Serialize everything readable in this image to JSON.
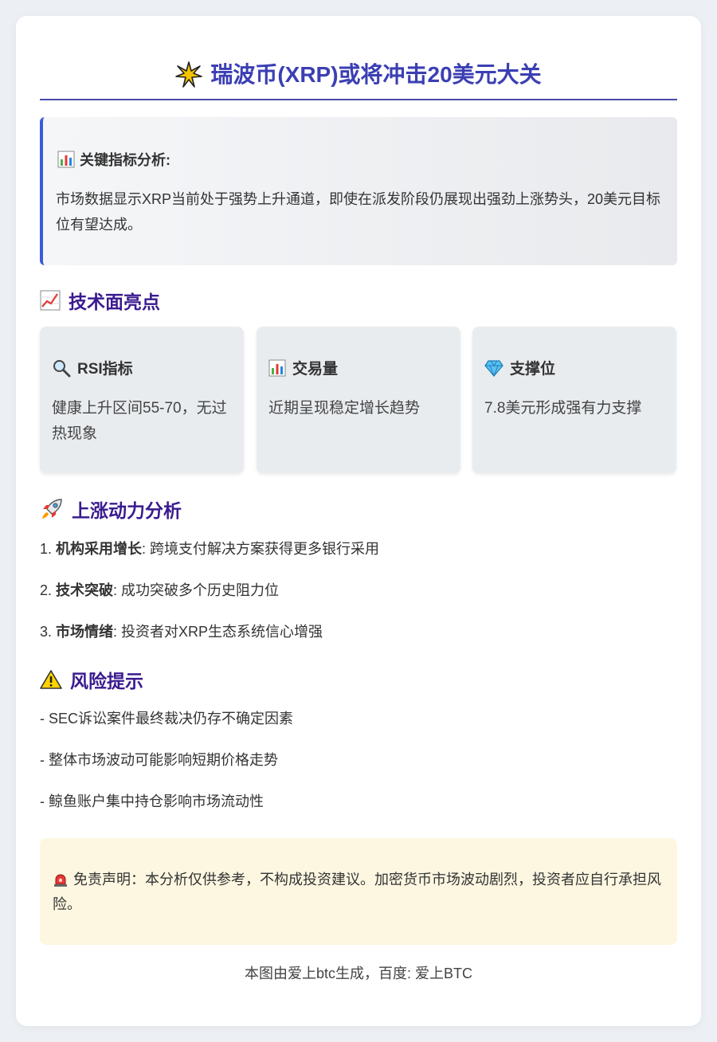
{
  "title": {
    "icon": "sparkle-burst-icon",
    "text": "瑞波币(XRP)或将冲击20美元大关"
  },
  "key_indicators": {
    "icon": "bar-chart-icon",
    "heading": "关键指标分析:",
    "text": "市场数据显示XRP当前处于强势上升通道，即使在派发阶段仍展现出强劲上涨势头，20美元目标位有望达成。"
  },
  "technical": {
    "icon": "chart-increasing-icon",
    "heading": "技术面亮点",
    "cards": [
      {
        "icon": "magnifier-icon",
        "title": "RSI指标",
        "text": "健康上升区间55-70，无过热现象"
      },
      {
        "icon": "bar-chart-icon",
        "title": "交易量",
        "text": "近期呈现稳定增长趋势"
      },
      {
        "icon": "gem-icon",
        "title": "支撑位",
        "text": "7.8美元形成强有力支撑"
      }
    ]
  },
  "momentum": {
    "icon": "rocket-icon",
    "heading": "上涨动力分析",
    "items": [
      {
        "num": "1.",
        "label": "机构采用增长",
        "sep": ": ",
        "text": "跨境支付解决方案获得更多银行采用"
      },
      {
        "num": "2.",
        "label": "技术突破",
        "sep": ": ",
        "text": "成功突破多个历史阻力位"
      },
      {
        "num": "3.",
        "label": "市场情绪",
        "sep": ": ",
        "text": "投资者对XRP生态系统信心增强"
      }
    ]
  },
  "risk": {
    "icon": "warning-icon",
    "heading": "风险提示",
    "items": [
      "- SEC诉讼案件最终裁决仍存不确定因素",
      "- 整体市场波动可能影响短期价格走势",
      "- 鲸鱼账户集中持仓影响市场流动性"
    ]
  },
  "disclaimer": {
    "icon": "siren-icon",
    "text": "免责声明：本分析仅供参考，不构成投资建议。加密货币市场波动剧烈，投资者应自行承担风险。"
  },
  "footer": {
    "text": "本图由爱上btc生成，百度: 爱上BTC"
  },
  "colors": {
    "title": "#3b3fb3",
    "section_heading": "#3a1a8f",
    "accent_border": "#3b5bdb",
    "disclaimer_bg": "#fdf7e1"
  }
}
